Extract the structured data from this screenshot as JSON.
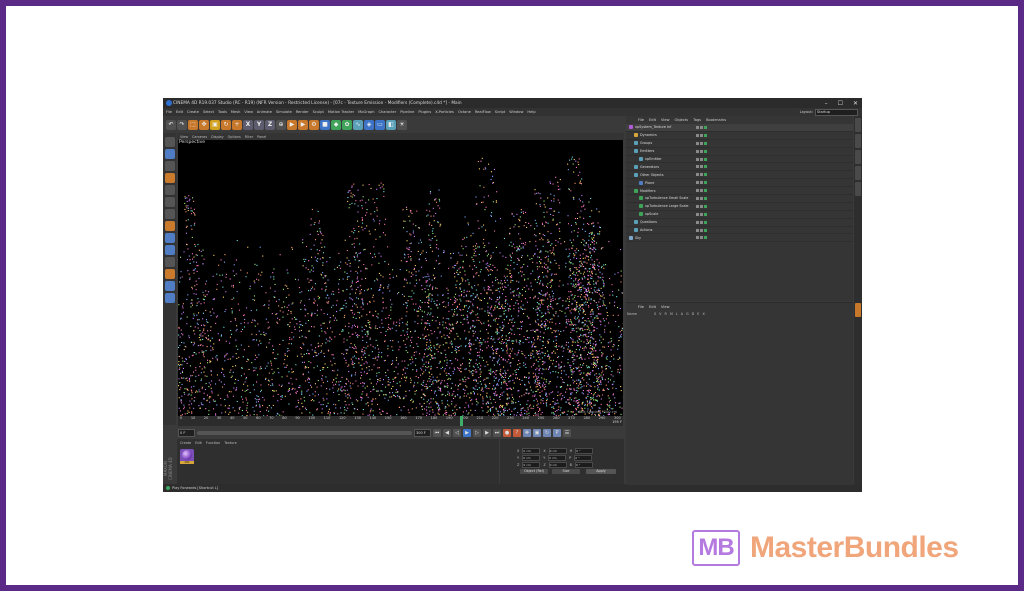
{
  "window": {
    "title": "CINEMA 4D R19.037 Studio (RC - R19) (NFR Version - Restricted License) - [07c - Texture Emission - Modifiers (Complete).c4d *] - Main",
    "controls": [
      "–",
      "☐",
      "✕"
    ]
  },
  "menubar": {
    "items": [
      "File",
      "Edit",
      "Create",
      "Select",
      "Tools",
      "Mesh",
      "View",
      "Animate",
      "Simulate",
      "Render",
      "Sculpt",
      "Motion Tracker",
      "MoGraph",
      "Character",
      "Pipeline",
      "Plugins",
      "X-Particles",
      "Octane",
      "RealFlow",
      "Script",
      "Window",
      "Help"
    ],
    "layout_label": "Layout:",
    "layout_value": "Startup"
  },
  "toolbar": {
    "axis_x": "X",
    "axis_y": "Y",
    "axis_z": "Z"
  },
  "viewport": {
    "menu": [
      "View",
      "Cameras",
      "Display",
      "Options",
      "Filter",
      "Panel"
    ],
    "label": "Perspective",
    "grid_spacing": "Grid Spacing : 100 cm",
    "particle_colors": [
      "#ff7fd0",
      "#c77dff",
      "#7fa8ff",
      "#6fe3e0",
      "#ffd36b",
      "#ff9b6b",
      "#9bf07a",
      "#f56fb0"
    ]
  },
  "timeline": {
    "ticks": [
      "0",
      "10",
      "20",
      "30",
      "40",
      "50",
      "60",
      "70",
      "80",
      "90",
      "100",
      "110",
      "120",
      "130",
      "140",
      "150",
      "160",
      "170",
      "180",
      "190",
      "200",
      "210",
      "220",
      "230",
      "240",
      "250",
      "260",
      "270",
      "280",
      "290",
      "300"
    ],
    "end_label": "195 F"
  },
  "transport": {
    "start_frame": "0 F",
    "end_frame": "300 F"
  },
  "material_manager": {
    "menu": [
      "Create",
      "Edit",
      "Function",
      "Texture"
    ],
    "material_label": "Mat"
  },
  "branding_sidebar": "MAXON CINEMA 4D",
  "coordinates": {
    "rows": [
      {
        "axis": "X",
        "val1": "0 cm",
        "axis2": "X",
        "val2": "0 cm",
        "axis3": "H",
        "val3": "0 °"
      },
      {
        "axis": "Y",
        "val1": "0 cm",
        "axis2": "Y",
        "val2": "0 cm",
        "axis3": "P",
        "val3": "0 °"
      },
      {
        "axis": "Z",
        "val1": "0 cm",
        "axis2": "Z",
        "val2": "0 cm",
        "axis3": "B",
        "val3": "0 °"
      }
    ],
    "mode_object": "Object (Rel)",
    "mode_size": "Size",
    "apply": "Apply"
  },
  "status": {
    "text": "Play Forwards [Shortcut L]"
  },
  "object_manager": {
    "menu": [
      "File",
      "Edit",
      "View",
      "Objects",
      "Tags",
      "Bookmarks"
    ],
    "items": [
      {
        "name": "xpSystem_Texture Inf",
        "depth": 0,
        "color": "#b35ad6"
      },
      {
        "name": "Dynamics",
        "depth": 1,
        "color": "#d6a63a"
      },
      {
        "name": "Groups",
        "depth": 1,
        "color": "#5aa0b8"
      },
      {
        "name": "Emitters",
        "depth": 1,
        "color": "#5aa0b8"
      },
      {
        "name": "xpEmitter",
        "depth": 2,
        "color": "#5aa0b8"
      },
      {
        "name": "Generators",
        "depth": 1,
        "color": "#5aa0b8"
      },
      {
        "name": "Other Objects",
        "depth": 1,
        "color": "#5aa0b8"
      },
      {
        "name": "Plane",
        "depth": 2,
        "color": "#4f7cc2"
      },
      {
        "name": "Modifiers",
        "depth": 1,
        "color": "#3fa45a"
      },
      {
        "name": "xpTurbulence Small Scale",
        "depth": 2,
        "color": "#3fa45a"
      },
      {
        "name": "xpTurbulence Large Scale",
        "depth": 2,
        "color": "#3fa45a"
      },
      {
        "name": "xpScale",
        "depth": 2,
        "color": "#3fa45a"
      },
      {
        "name": "Questions",
        "depth": 1,
        "color": "#5aa0b8"
      },
      {
        "name": "Actions",
        "depth": 1,
        "color": "#5aa0b8"
      },
      {
        "name": "Sky",
        "depth": 0,
        "color": "#7fa8c8"
      }
    ]
  },
  "attribute_manager": {
    "menu": [
      "File",
      "Edit",
      "View"
    ],
    "header": [
      "Name",
      "S",
      "V",
      "R",
      "M",
      "L",
      "A",
      "G",
      "D",
      "E",
      "X"
    ]
  },
  "masterbundles": {
    "logo": "MB",
    "name": "MasterBundles",
    "logo_color": "#b57ae0",
    "text_color": "#f0a57b"
  }
}
